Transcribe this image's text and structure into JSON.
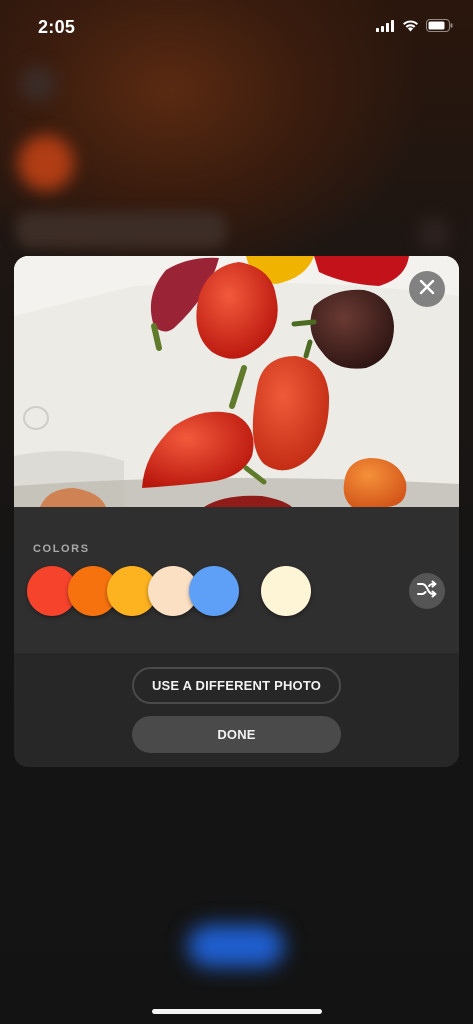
{
  "status_bar": {
    "time": "2:05",
    "icons": [
      "cellular-signal-icon",
      "wifi-icon",
      "battery-icon"
    ]
  },
  "photo_card": {
    "photo_subject": "peppers",
    "close_icon": "close-icon"
  },
  "colors": {
    "label": "COLORS",
    "swatches": [
      {
        "name": "red",
        "hex": "#F5432C"
      },
      {
        "name": "orange",
        "hex": "#F6720F"
      },
      {
        "name": "yellow",
        "hex": "#FDB220"
      },
      {
        "name": "peach",
        "hex": "#FCE0C4"
      },
      {
        "name": "blue",
        "hex": "#5EA0F7"
      }
    ],
    "selected_swatch": {
      "name": "cream",
      "hex": "#FEF5D6"
    },
    "shuffle_icon": "shuffle-icon"
  },
  "actions": {
    "use_different_photo_label": "USE A DIFFERENT PHOTO",
    "done_label": "DONE"
  },
  "theme": {
    "accent_blur_blue": "#1f5fd0",
    "accent_blur_orange": "#c4451b"
  }
}
